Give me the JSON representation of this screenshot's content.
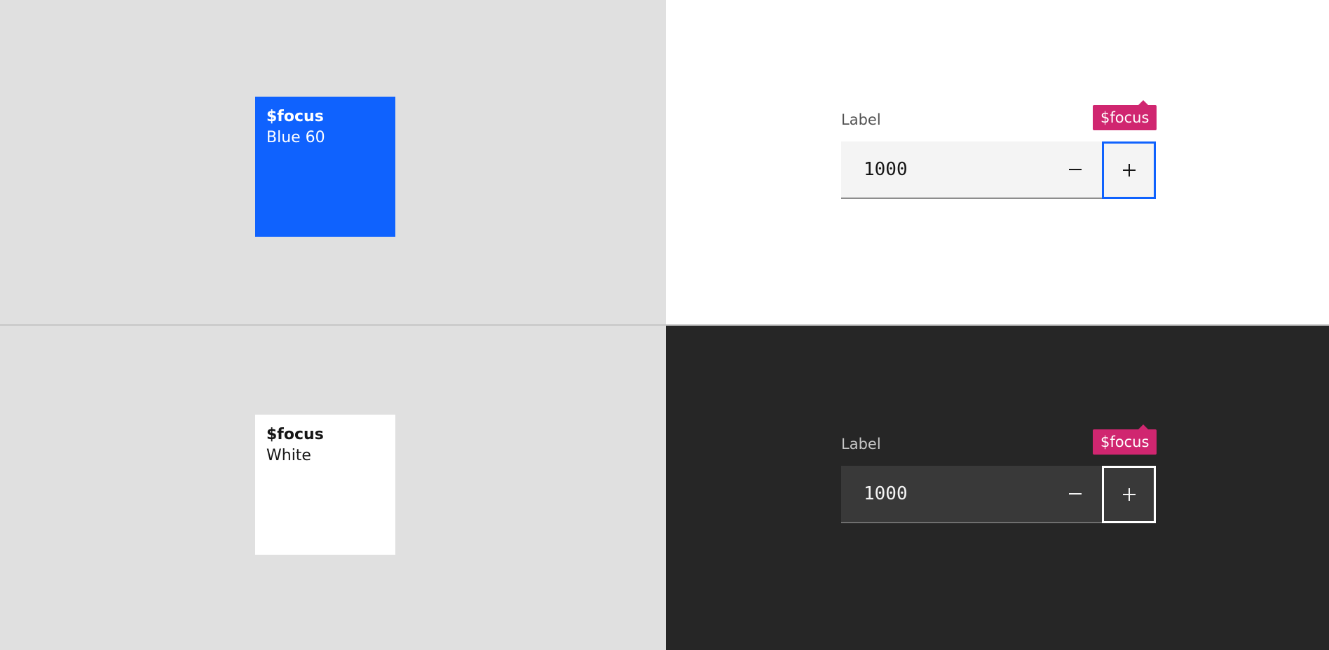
{
  "swatches": [
    {
      "token": "$focus",
      "name": "Blue 60",
      "color": "#0f62fe"
    },
    {
      "token": "$focus",
      "name": "White",
      "color": "#ffffff"
    }
  ],
  "light_example": {
    "label": "Label",
    "value": "1000",
    "decrement_icon": "minus-icon",
    "increment_icon": "plus-icon",
    "annotation": "$focus"
  },
  "dark_example": {
    "label": "Label",
    "value": "1000",
    "decrement_icon": "minus-icon",
    "increment_icon": "plus-icon",
    "annotation": "$focus"
  },
  "colors": {
    "focus_blue": "#0f62fe",
    "focus_white": "#ffffff",
    "annotation_magenta": "#d02670",
    "light_panel": "#e0e0e0",
    "dark_panel": "#262626"
  }
}
